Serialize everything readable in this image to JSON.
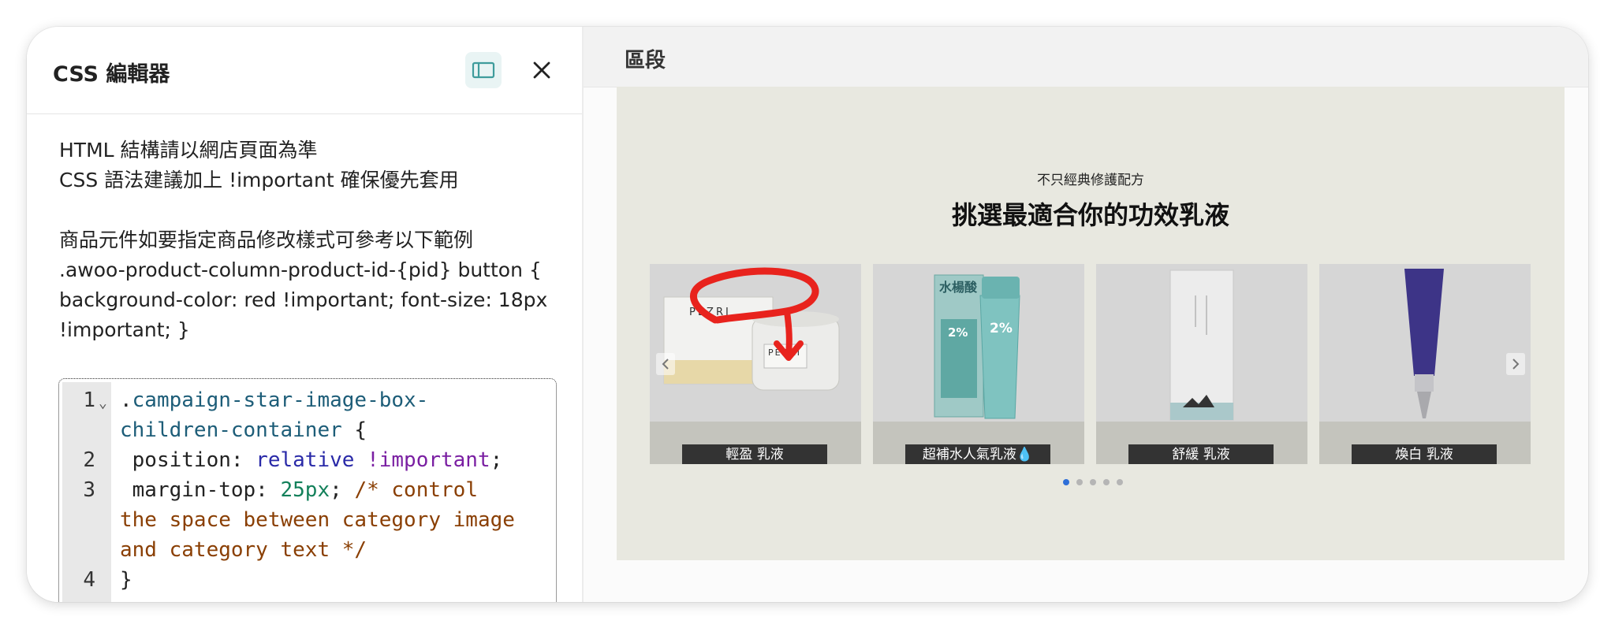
{
  "left_panel": {
    "title": "CSS 編輯器",
    "toggle_icon": "sidebar-layout-icon",
    "close_icon": "close-icon",
    "help_lines_1": [
      "HTML 結構請以網店頁面為準",
      "CSS 語法建議加上 !important 確保優先套用"
    ],
    "help_lines_2": [
      "商品元件如要指定商品修改樣式可參考以下範例",
      ".awoo-product-column-product-id-{pid} button {",
      "background-color: red !important; font-size: 18px",
      "!important; }"
    ]
  },
  "editor": {
    "line_numbers": [
      "1",
      "2",
      "3",
      "4"
    ],
    "code": {
      "l1a": ".",
      "l1b": "campaign-star-image-box-",
      "l1c": "children-container",
      "l1d": " {",
      "l2a": " position: ",
      "l2b": "relative",
      "l2c": " ",
      "l2d": "!important",
      "l2e": ";",
      "l3a": " margin-top: ",
      "l3b": "25px",
      "l3c": "; ",
      "l3d": "/* control",
      "l3e": "the space between category image",
      "l3f": "and category text */",
      "l4": "}"
    }
  },
  "right_panel": {
    "title": "區段",
    "preview": {
      "subtitle": "不只經典修護配方",
      "title": "挑選最適合你的功效乳液",
      "products": [
        {
          "label": "輕盈 乳液"
        },
        {
          "label": "超補水人氣乳液💧"
        },
        {
          "label": "舒緩 乳液"
        },
        {
          "label": "煥白 乳液"
        }
      ],
      "brand": "PEZRI",
      "product_text": "水楊酸",
      "percent": "2%",
      "dots_count": 5,
      "active_dot": 0
    }
  },
  "colors": {
    "annotation": "#e8231d",
    "preview_bg": "#e8e8e0",
    "active_dot": "#2e6fd8"
  }
}
